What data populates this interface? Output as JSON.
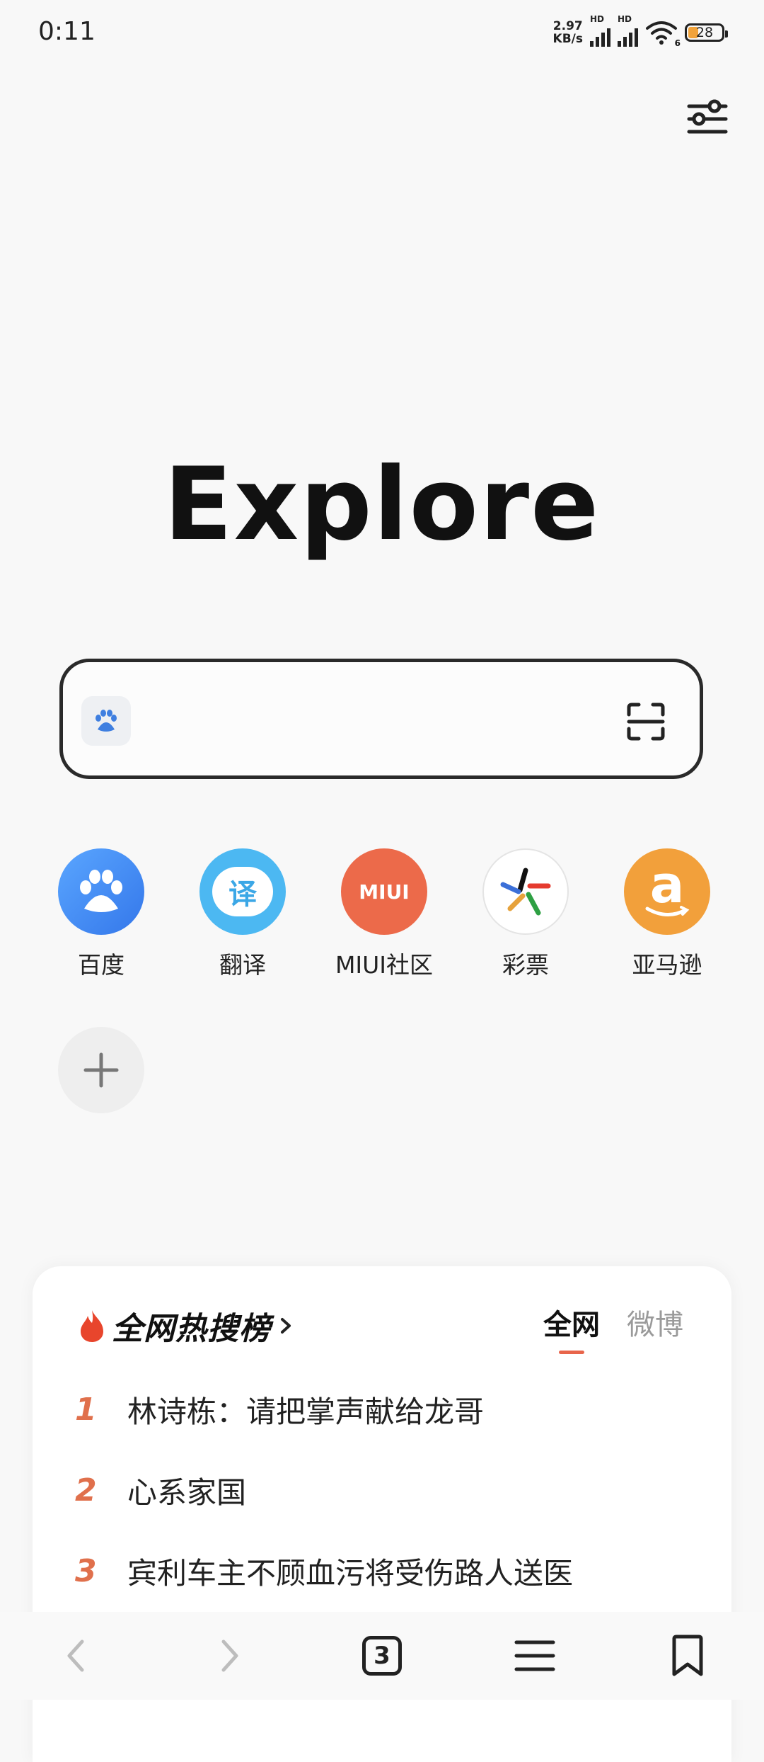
{
  "status_bar": {
    "time": "0:11",
    "net_speed_value": "2.97",
    "net_speed_unit": "KB/s",
    "sim1_badge": "HD",
    "sim2_badge": "HD",
    "wifi_badge": "6",
    "battery_level": "28"
  },
  "header": {
    "settings_icon": "sliders-icon"
  },
  "logo": {
    "text": "Explore"
  },
  "search": {
    "engine_icon": "baidu-paw-icon",
    "value": "",
    "placeholder": "",
    "scan_icon": "scan-icon"
  },
  "shortcuts": [
    {
      "label": "百度",
      "icon": "baidu-icon",
      "color": "#3f8ef0"
    },
    {
      "label": "翻译",
      "icon": "translate-icon",
      "color": "#49b6f0"
    },
    {
      "label": "MIUI社区",
      "icon": "miui-icon",
      "color": "#ec6a4a",
      "icon_text": "MIUI"
    },
    {
      "label": "彩票",
      "icon": "lottery-icon",
      "color": "#ffffff"
    },
    {
      "label": "亚马逊",
      "icon": "amazon-icon",
      "color": "#f2a03b",
      "icon_text": "a"
    }
  ],
  "add_shortcut": {
    "icon": "plus-icon"
  },
  "hot_list": {
    "title": "全网热搜榜",
    "tabs": [
      {
        "label": "全网",
        "active": true
      },
      {
        "label": "微博",
        "active": false
      }
    ],
    "items": [
      {
        "rank": "1",
        "text": "林诗栋：请把掌声献给龙哥"
      },
      {
        "rank": "2",
        "text": "心系家国"
      },
      {
        "rank": "3",
        "text": "宾利车主不顾血污将受伤路人送医"
      }
    ]
  },
  "bottom_nav": {
    "back_icon": "chevron-left-icon",
    "forward_icon": "chevron-right-icon",
    "tab_count": "3",
    "menu_icon": "menu-icon",
    "bookmark_icon": "bookmark-icon"
  }
}
